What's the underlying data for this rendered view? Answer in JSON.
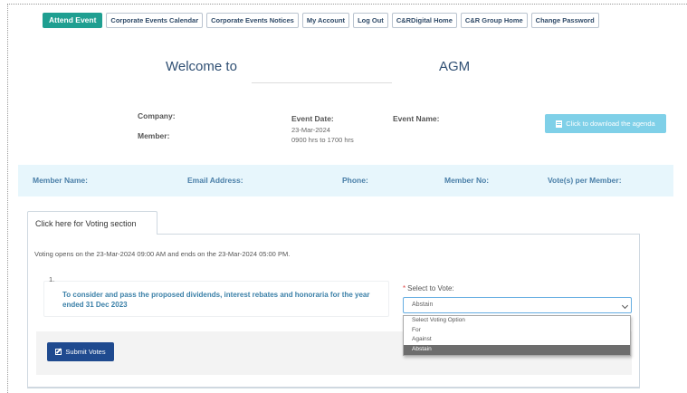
{
  "nav": {
    "items": [
      {
        "label": "Attend Event",
        "active": true
      },
      {
        "label": "Corporate Events Calendar",
        "active": false
      },
      {
        "label": "Corporate Events Notices",
        "active": false
      },
      {
        "label": "My Account",
        "active": false
      },
      {
        "label": "Log Out",
        "active": false
      },
      {
        "label": "C&RDigital Home",
        "active": false
      },
      {
        "label": "C&R Group Home",
        "active": false
      },
      {
        "label": "Change Password",
        "active": false
      }
    ]
  },
  "welcome": {
    "text": "Welcome to",
    "event": "AGM"
  },
  "info": {
    "company_label": "Company:",
    "member_label": "Member:",
    "event_date_label": "Event Date:",
    "event_date": "23-Mar-2024",
    "event_time": "0900 hrs to 1700 hrs",
    "event_name_label": "Event Name:",
    "agenda_button": "Click to download the agenda"
  },
  "member_table": {
    "columns": [
      "Member Name:",
      "Email Address:",
      "Phone:",
      "Member No:",
      "Vote(s) per Member:"
    ]
  },
  "voting": {
    "tab_label": "Click here for Voting section",
    "window_text": "Voting opens on the 23-Mar-2024 09:00 AM and ends on the 23-Mar-2024 05:00 PM.",
    "resolution_number": "1.",
    "resolution_text": "To consider and pass the proposed dividends, interest rebates and honoraria for the year ended 31 Dec 2023",
    "required_marker": "*",
    "select_label": "Select to Vote:",
    "selected_value": "Abstain",
    "options": [
      "Select Voting Option",
      "For",
      "Against",
      "Abstain"
    ],
    "highlighted_option": "Abstain",
    "submit_label": "Submit Votes"
  },
  "colors": {
    "accent_teal": "#1f9f91",
    "agenda_button": "#7fd0e8",
    "submit_button": "#1f4a8f",
    "member_bar": "#e7f6fc",
    "resolution_text": "#3b80a8"
  }
}
